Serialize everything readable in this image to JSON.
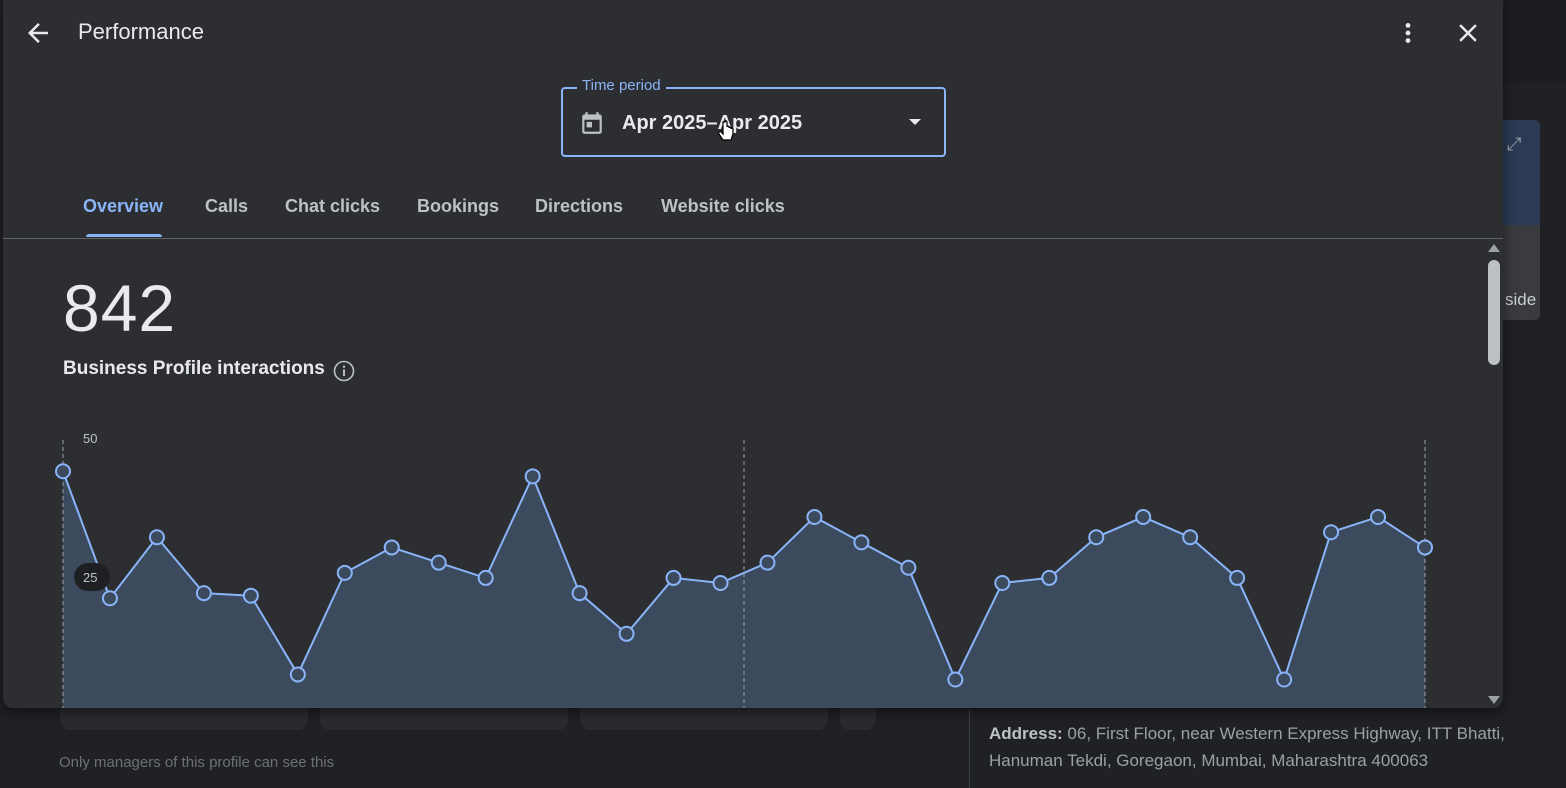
{
  "dialog": {
    "title": "Performance",
    "time_period": {
      "label": "Time period",
      "value": "Apr 2025–Apr 2025"
    },
    "tabs": [
      {
        "label": "Overview",
        "active": true
      },
      {
        "label": "Calls"
      },
      {
        "label": "Chat clicks"
      },
      {
        "label": "Bookings"
      },
      {
        "label": "Directions"
      },
      {
        "label": "Website clicks"
      }
    ],
    "metric": {
      "value": "842",
      "label": "Business Profile interactions"
    }
  },
  "background": {
    "note": "Only managers of this profile can see this",
    "address_label": "Address:",
    "address_line1": "06, First Floor, near Western Express Highway, ITT Bhatti,",
    "address_line2": "Hanuman Tekdi, Goregaon, Mumbai, Maharashtra 400063",
    "side_label": "side"
  },
  "icons": {
    "back": "arrow-left-icon",
    "more": "more-vert-icon",
    "close": "close-icon",
    "calendar": "calendar-icon",
    "info": "info-icon",
    "dropdown": "caret-down-icon"
  },
  "colors": {
    "accent": "#8ab4f8",
    "area_fill": "#3c4a5e",
    "dialog_bg": "#2d2e31"
  },
  "chart_data": {
    "type": "area",
    "y_ticks": [
      "50",
      "25"
    ],
    "ylim": [
      0,
      50
    ],
    "values": [
      47,
      22,
      34,
      23,
      22.5,
      7,
      27,
      32,
      29,
      26,
      46,
      23,
      15,
      26,
      25,
      29,
      38,
      33,
      28,
      6,
      25,
      26,
      34,
      38,
      34,
      26,
      6,
      35,
      38,
      32
    ]
  }
}
